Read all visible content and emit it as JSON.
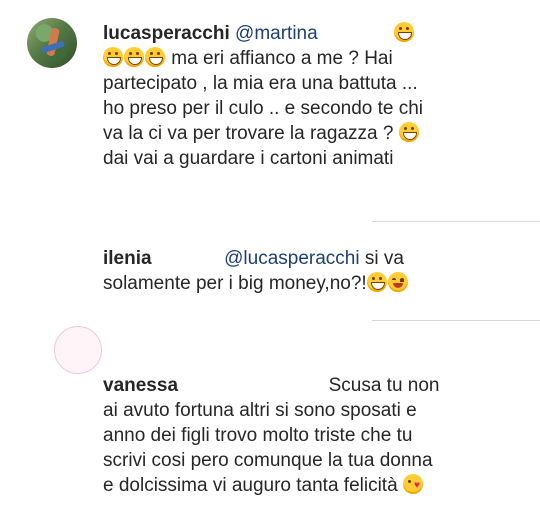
{
  "comments": [
    {
      "username": "lucasperacchi",
      "mention": "@martina",
      "lines": [
        "ma eri affianco a me ? Hai",
        "partecipato , la mia era una battuta ...",
        "ho preso per il culo .. e secondo te chi",
        "va la ci va per trovare la ragazza ?",
        "dai vai a guardare i cartoni animati"
      ]
    },
    {
      "username": "ilenia",
      "mention": "@lucasperacchi",
      "text_after_mention": "si va",
      "lines": [
        "solamente per i big money,no?!"
      ]
    },
    {
      "username": "vanessa",
      "text_after_name": "Scusa tu non",
      "lines": [
        "ai avuto fortuna altri si sono sposati e",
        "anno dei figli trovo molto triste che tu",
        "scrivi cosi pero comunque la tua donna",
        "e dolcissima vi auguro tanta felicità"
      ]
    }
  ],
  "emoji_names": [
    "grinning-face-icon",
    "smiling-face-icon",
    "kiss-face-icon"
  ],
  "colors": {
    "mention": "#1d3f73",
    "text": "#262626",
    "divider": "#d8d8d8"
  }
}
